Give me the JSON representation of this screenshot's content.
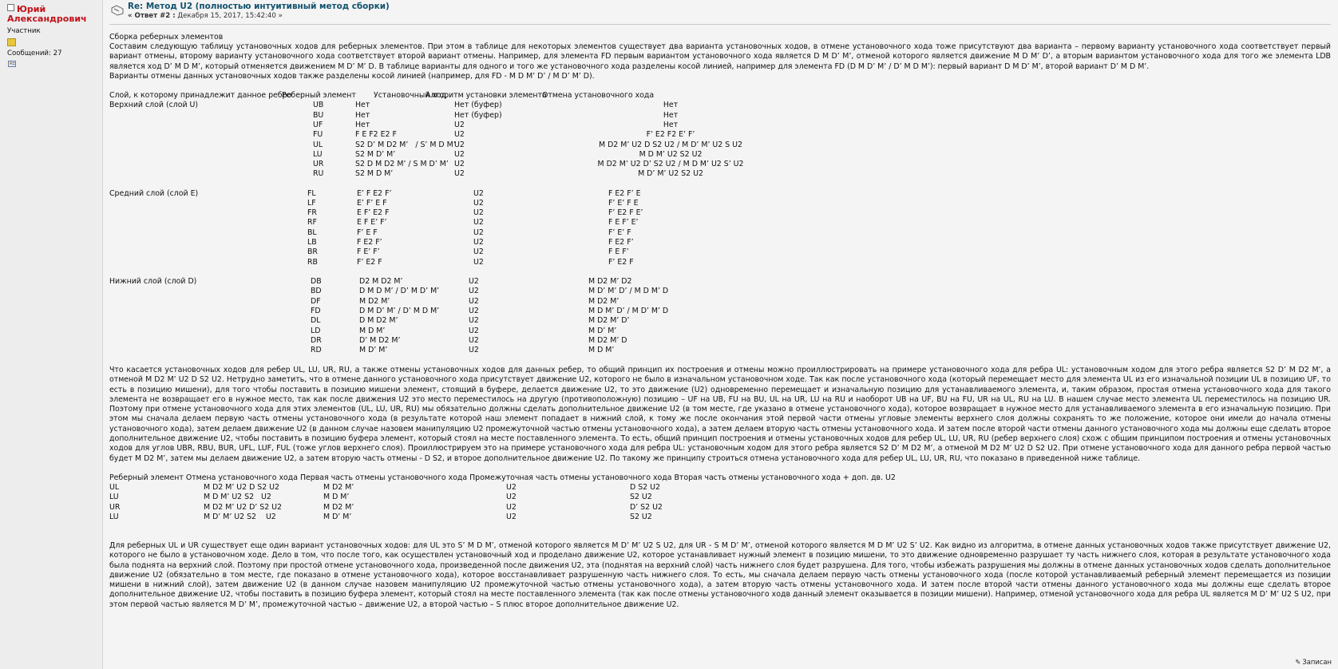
{
  "author": {
    "name_line1": "Юрий",
    "name_line2": "Александрович",
    "role": "Участник",
    "posts": "Сообщений: 27"
  },
  "post": {
    "title": "Re: Метод U2 (полностью интуитивный метод сборки)",
    "reply_label": "« Ответ #2 :",
    "date": " Декабря 15, 2017, 15:42:40 »"
  },
  "intro": {
    "heading": "Сборка реберных элементов",
    "p1": "Составим следующую таблицу установочных ходов для реберных элементов. При этом в таблице для некоторых элементов существует два варианта установочных ходов, в отмене установочного хода тоже присутствуют два варианта – первому варианту установочного хода соответствует первый вариант отмены, второму варианту установочного хода соответствует второй вариант отмены. Например, для элемента FD первым вариантом установочного хода является D M D’ M’, отменой которого является движение M D M’ D’, а вторым вариантом установочного хода для того же элемента LDB является ход  D’ M D M’, который отменяется движением M D’ M’ D. В таблице варианты для одного и того же установочного хода разделены косой линией, например для элемента FD (D M D’ M’ / D’ M D M’): первый вариант D M D’ M’, второй вариант  D’ M D M’.",
    "p2": "Варианты отмены данных установочных ходов также разделены косой линией (например, для FD - M D M’ D’ / M D’ M’ D)."
  },
  "table1": {
    "headers": [
      "Слой, к которому принадлежит данное ребро",
      "Реберный элемент",
      "Установочный ход",
      "Алгоритм установки элемента",
      "Отмена установочного хода"
    ],
    "groups": [
      {
        "layer": "Верхний слой (слой U)",
        "rows": [
          [
            "UB",
            "Нет",
            "Нет (буфер)",
            "Нет"
          ],
          [
            "BU",
            "Нет",
            "Нет (буфер)",
            "Нет"
          ],
          [
            "UF",
            "Нет",
            "U2",
            "Нет"
          ],
          [
            "FU",
            "F E F2 E2 F",
            "U2",
            "F’ E2 F2 E’ F’"
          ],
          [
            "UL",
            "S2 D’ M D2 M’   / S’ M D M’",
            "U2",
            "M D2 M’ U2 D S2 U2 / M D’ M’ U2 S U2"
          ],
          [
            "LU",
            "S2 M D’ M’",
            "U2",
            "M D M’ U2 S2 U2"
          ],
          [
            "UR",
            "S2 D M D2 M’ / S M D’ M’",
            "U2",
            "M D2 M’ U2 D’ S2 U2 / M D M’ U2 S’ U2"
          ],
          [
            "RU",
            "S2 M D M’",
            "U2",
            "M D’ M’ U2 S2 U2"
          ]
        ]
      },
      {
        "layer": "Средний слой (слой E)",
        "rows": [
          [
            "FL",
            "E’ F E2 F’",
            "U2",
            "F E2 F’ E"
          ],
          [
            "LF",
            "E’ F’ E F",
            "U2",
            "F’ E’ F E"
          ],
          [
            "FR",
            "E F’ E2 F",
            "U2",
            "F’ E2 F E’"
          ],
          [
            "RF",
            "E F E’ F’",
            "U2",
            "F E F’ E’"
          ],
          [
            "BL",
            "F’ E F",
            "U2",
            "F’ E’ F"
          ],
          [
            "LB",
            "F E2 F’",
            "U2",
            "F E2 F’"
          ],
          [
            "BR",
            "F E’ F’",
            "U2",
            "F E F’"
          ],
          [
            "RB",
            "F’ E2 F",
            "U2",
            "F’ E2 F"
          ]
        ]
      },
      {
        "layer": "Нижний слой (слой D)",
        "rows": [
          [
            "DB",
            "D2 M D2 M’",
            "U2",
            "M D2 M’ D2"
          ],
          [
            "BD",
            "D M D M’ / D’ M D’ M’",
            "U2",
            "M D’ M’ D’ / M D M’ D"
          ],
          [
            "DF",
            "M D2 M’",
            "U2",
            "M D2 M’"
          ],
          [
            "FD",
            "D M D’ M’ / D’ M D M’",
            "U2",
            "M D M’ D’ / M D’ M’ D"
          ],
          [
            "DL",
            "D M D2 M’",
            "U2",
            "M D2 M’ D’"
          ],
          [
            "LD",
            "M D M’",
            "U2",
            "M D’ M’"
          ],
          [
            "DR",
            "D’ M D2 M’",
            "U2",
            "M D2 M’ D"
          ],
          [
            "RD",
            "M D’ M’",
            "U2",
            "M D M’"
          ]
        ]
      }
    ]
  },
  "middle_para": "Что касается установочных ходов для ребер UL, LU, UR, RU, а также отмены установочных ходов для данных ребер, то общий принцип их построения и отмены можно проиллюстрировать на примере установочного хода для ребра UL: установочным ходом для этого ребра является S2 D’ M D2 M’, а отменой M D2 M’ U2 D S2 U2. Нетрудно заметить, что в отмене данного установочного хода присутствует движение U2, которого не было в изначальном установочном ходе. Так как после установочного хода (который перемещает место для элемента UL из его изначальной позиции UL в позицию UF, то есть в позицию мишени), для того чтобы поставить в позицию мишени элемент, стоящий в буфере, делается движение U2, то это движение (U2) одновременно перемещает и изначальную позицию для устанавливаемого элемента, и, таким образом, простая отмена установочного хода для такого элемента не возвращает его в нужное место, так как после движения U2 это место переместилось на другую (противоположную) позицию – UF на UB, FU на BU, UL на UR, LU на RU и наоборот UB на UF, BU на FU, UR на UL, RU на LU. В нашем случае место элемента UL переместилось на позицию UR. Поэтому при отмене установочного хода для этих элементов (UL, LU, UR, RU) мы обязательно должны сделать дополнительное движение U2 (в том месте, где указано в отмене установочного хода), которое возвращает в нужное место для устанавливаемого элемента в его изначальную позицию. При этом мы сначала делаем первую часть отмены установочного хода (в результате которой наш элемент попадает в нижний слой, к тому же после окончания этой первой части отмены угловые элементы верхнего слоя должны сохранять то же положение, которое они имели до начала отмены установочного хода), затем делаем движение U2 (в данном случае назовем манипуляцию U2 промежуточной частью отмены установочного хода), а затем делаем вторую часть отмены установочного хода. И затем после второй части отмены данного установочного хода мы должны еще сделать второе дополнительное движение U2, чтобы поставить в позицию буфера элемент, который стоял на месте поставленного элемента. То есть, общий принцип построения и отмены установочных ходов для ребер UL, LU, UR, RU (ребер верхнего слоя) схож с общим принципом построения и отмены установочных ходов для углов UBR, RBU, BUR, UFL, LUF, FUL (тоже углов верхнего слоя). Проиллюстрируем это на примере установочного хода для ребра UL: установочным ходом для этого ребра является S2 D’ M D2 M’, а отменой M D2 M’ U2 D S2 U2. При отмене установочного хода для данного ребра первой частью будет M D2 M’, затем мы делаем движение U2, а затем вторую часть отмены - D S2, и второе дополнительное движение U2.  По такому же принципу строиться отмена установочного хода для ребер UL, LU, UR, RU, что показано в приведенной ниже таблице.",
  "table2": {
    "header": "Реберный элемент Отмена установочного хода Первая часть отмены установочного хода Промежуточная часть отмены установочного хода Вторая часть отмены установочного хода + доп. дв. U2",
    "rows": [
      [
        "UL",
        "M D2 M’ U2 D S2 U2",
        "M D2 M’",
        "U2",
        "D S2 U2"
      ],
      [
        "LU",
        "M D M’ U2 S2   U2",
        "M D M’",
        "U2",
        "S2 U2"
      ],
      [
        "UR",
        "M D2 M’ U2 D’ S2 U2",
        "M D2 M’",
        "U2",
        "D’ S2 U2"
      ],
      [
        "LU",
        "M D’ M’ U2 S2    U2",
        "M D’ M’",
        "U2",
        "S2 U2"
      ]
    ]
  },
  "last_para": "Для реберных UL и UR существует еще один вариант установочных ходов: для UL это S’ M D M’, отменой которого является M D’ M’ U2 S U2, для UR - S M D’ M’, отменой которого является M D M’ U2 S’ U2. Как видно из алгоритма, в отмене данных установочных ходов также присутствует движение U2, которого не было в установочном ходе. Дело в том, что после того, как осуществлен установочный ход и проделано движение U2, которое устанавливает нужный элемент в позицию мишени, то это движение одновременно разрушает ту часть нижнего слоя, которая в результате установочного хода была поднята на верхний слой. Поэтому при простой отмене установочного хода, произведенной после движения U2, эта (поднятая на верхний слой) часть нижнего слоя будет разрушена. Для того, чтобы избежать разрушения мы должны в отмене данных установочных ходов сделать дополнительное движение U2 (обязательно в том месте, где показано в отмене установочного хода), которое восстанавливает разрушенную часть нижнего слоя. То есть, мы сначала делаем первую часть отмены установочного хода (после которой устанавливаемый реберный элемент перемещается из позиции мишени в нижний слой), затем движение U2 (в данном случае назовем манипуляцию U2 промежуточной частью отмены установочного хода), а затем вторую часть отмены установочного хода. И затем после второй части отмены данного установочного хода мы должны еще сделать второе дополнительное движение U2, чтобы поставить в позицию буфера элемент, который стоял на месте поставленного элемента (так как после отмены установочного ходв данный элемент оказывается в позиции мишени). Например, отменой установочного хода для ребра UL является M D’ M’ U2 S U2, при этом первой частью является M D’ M’, промежуточной частью – движение U2, а второй частью – S плюс второе дополнительное движение U2.",
  "footer": {
    "record_label": "Записан"
  }
}
